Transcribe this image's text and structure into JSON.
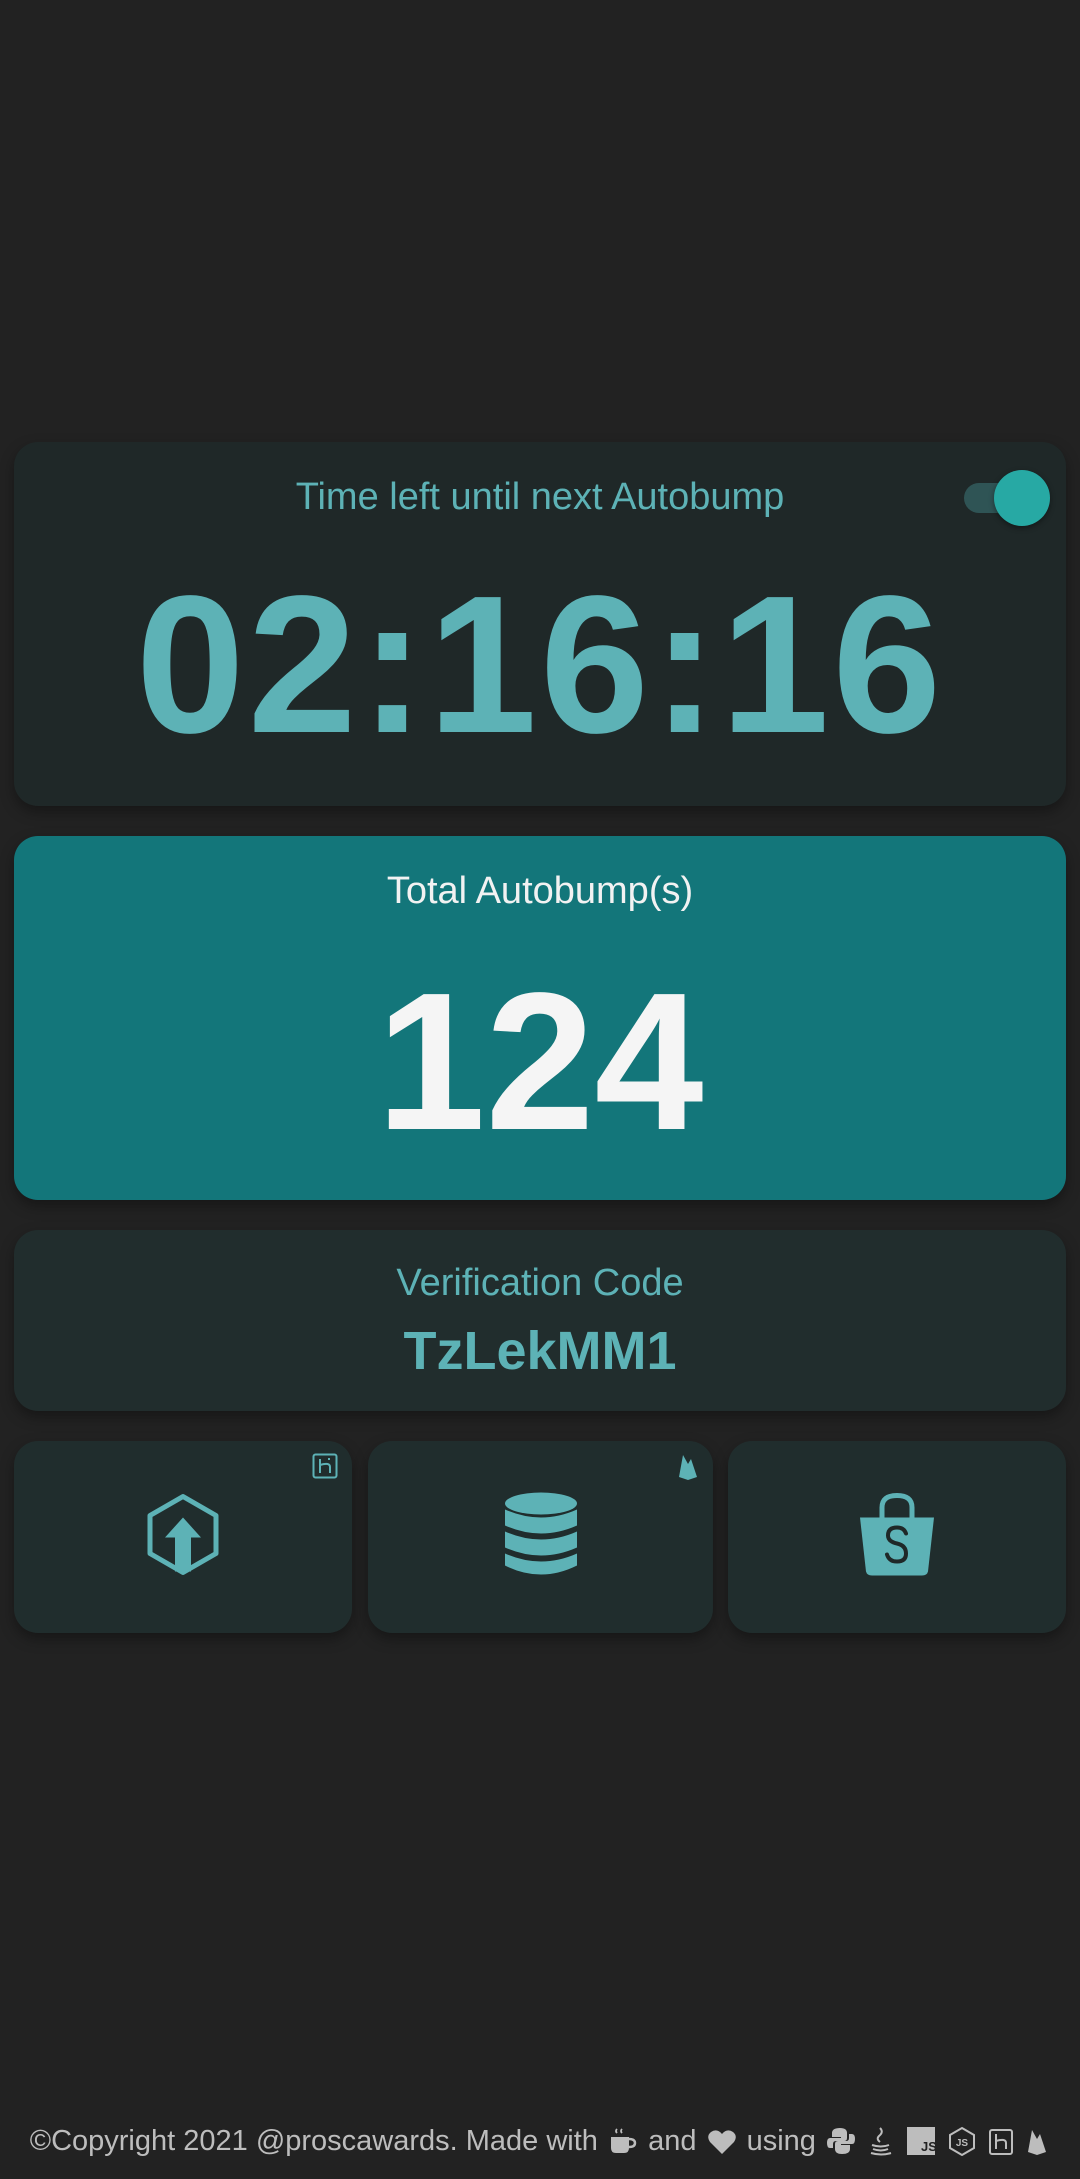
{
  "timer": {
    "title": "Time left until next Autobump",
    "value": "02:16:16",
    "autobump_enabled": true
  },
  "total": {
    "title": "Total Autobump(s)",
    "value": "124"
  },
  "verification": {
    "title": "Verification Code",
    "code": "TzLekMM1"
  },
  "tiles": [
    {
      "icon": "upload-hexagon-icon",
      "badge": "heroku-icon"
    },
    {
      "icon": "database-icon",
      "badge": "firebase-icon"
    },
    {
      "icon": "shopping-bag-icon"
    }
  ],
  "footer": {
    "prefix": "©Copyright 2021 @proscawards. Made with",
    "and": "and",
    "using": "using",
    "icons": [
      "coffee-icon",
      "heart-icon",
      "python-icon",
      "java-icon",
      "javascript-icon",
      "nodejs-icon",
      "heroku-icon",
      "firebase-icon"
    ]
  },
  "colors": {
    "background": "#222222",
    "card": "#1f2828",
    "accent": "#5db2b6",
    "teal": "#13767a",
    "toggle": "#27a9a4"
  }
}
